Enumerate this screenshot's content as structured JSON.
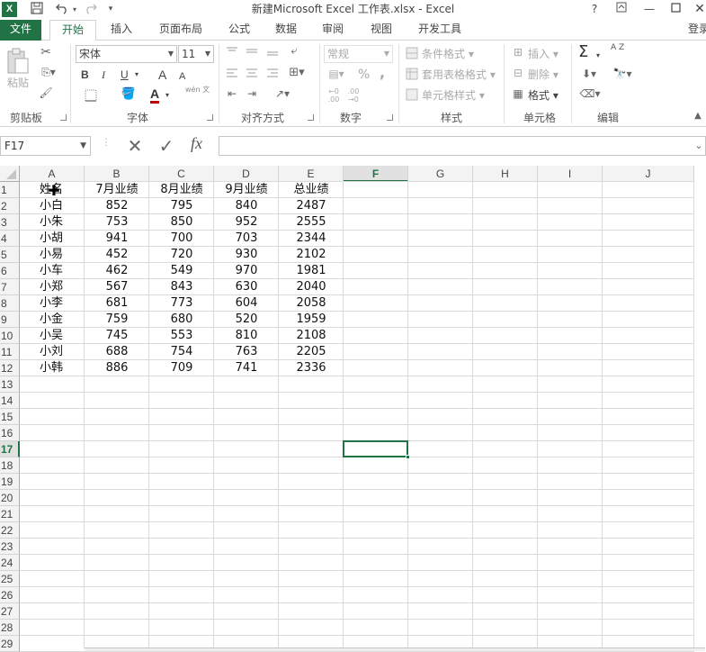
{
  "window": {
    "title": "新建Microsoft Excel 工作表.xlsx - Excel",
    "app_icon_text": "X",
    "help": "?",
    "signin": "登录"
  },
  "tabs": [
    "文件",
    "开始",
    "插入",
    "页面布局",
    "公式",
    "数据",
    "审阅",
    "视图",
    "开发工具"
  ],
  "ribbon": {
    "clipboard": {
      "paste": "粘贴",
      "label": "剪贴板"
    },
    "font": {
      "name": "宋体",
      "size": "11",
      "bold": "B",
      "italic": "I",
      "underline": "U",
      "grow": "A",
      "shrink": "A",
      "color_letter": "A",
      "wen": "wén 文",
      "label": "字体"
    },
    "alignment": {
      "label": "对齐方式"
    },
    "number": {
      "format": "常规",
      "percent": "%",
      "comma": ",",
      "label": "数字"
    },
    "styles": {
      "conditional": "条件格式",
      "table": "套用表格格式",
      "cell": "单元格样式",
      "label": "样式"
    },
    "cells": {
      "insert": "插入",
      "delete": "删除",
      "format": "格式",
      "label": "单元格"
    },
    "editing": {
      "sum": "Σ",
      "sort": "A Z",
      "label": "编辑"
    }
  },
  "formula_bar": {
    "name_box": "F17",
    "fx": "fx",
    "value": ""
  },
  "columns": [
    "A",
    "B",
    "C",
    "D",
    "E",
    "F",
    "G",
    "H",
    "I",
    "J"
  ],
  "selected_column": "F",
  "selected_row": "17",
  "rows": [
    "1",
    "2",
    "3",
    "4",
    "5",
    "6",
    "7",
    "8",
    "9",
    "10",
    "11",
    "12",
    "13",
    "14",
    "15",
    "16",
    "17",
    "18",
    "19",
    "20",
    "21",
    "22",
    "23",
    "24",
    "25",
    "26",
    "27",
    "28",
    "29"
  ],
  "table": {
    "header": [
      "姓名",
      "7月业绩",
      "8月业绩",
      "9月业绩",
      "总业绩"
    ],
    "data": [
      [
        "小白",
        "852",
        "795",
        "840",
        "2487"
      ],
      [
        "小朱",
        "753",
        "850",
        "952",
        "2555"
      ],
      [
        "小胡",
        "941",
        "700",
        "703",
        "2344"
      ],
      [
        "小易",
        "452",
        "720",
        "930",
        "2102"
      ],
      [
        "小车",
        "462",
        "549",
        "970",
        "1981"
      ],
      [
        "小郑",
        "567",
        "843",
        "630",
        "2040"
      ],
      [
        "小李",
        "681",
        "773",
        "604",
        "2058"
      ],
      [
        "小金",
        "759",
        "680",
        "520",
        "1959"
      ],
      [
        "小吴",
        "745",
        "553",
        "810",
        "2108"
      ],
      [
        "小刘",
        "688",
        "754",
        "763",
        "2205"
      ],
      [
        "小韩",
        "886",
        "709",
        "741",
        "2336"
      ]
    ]
  }
}
